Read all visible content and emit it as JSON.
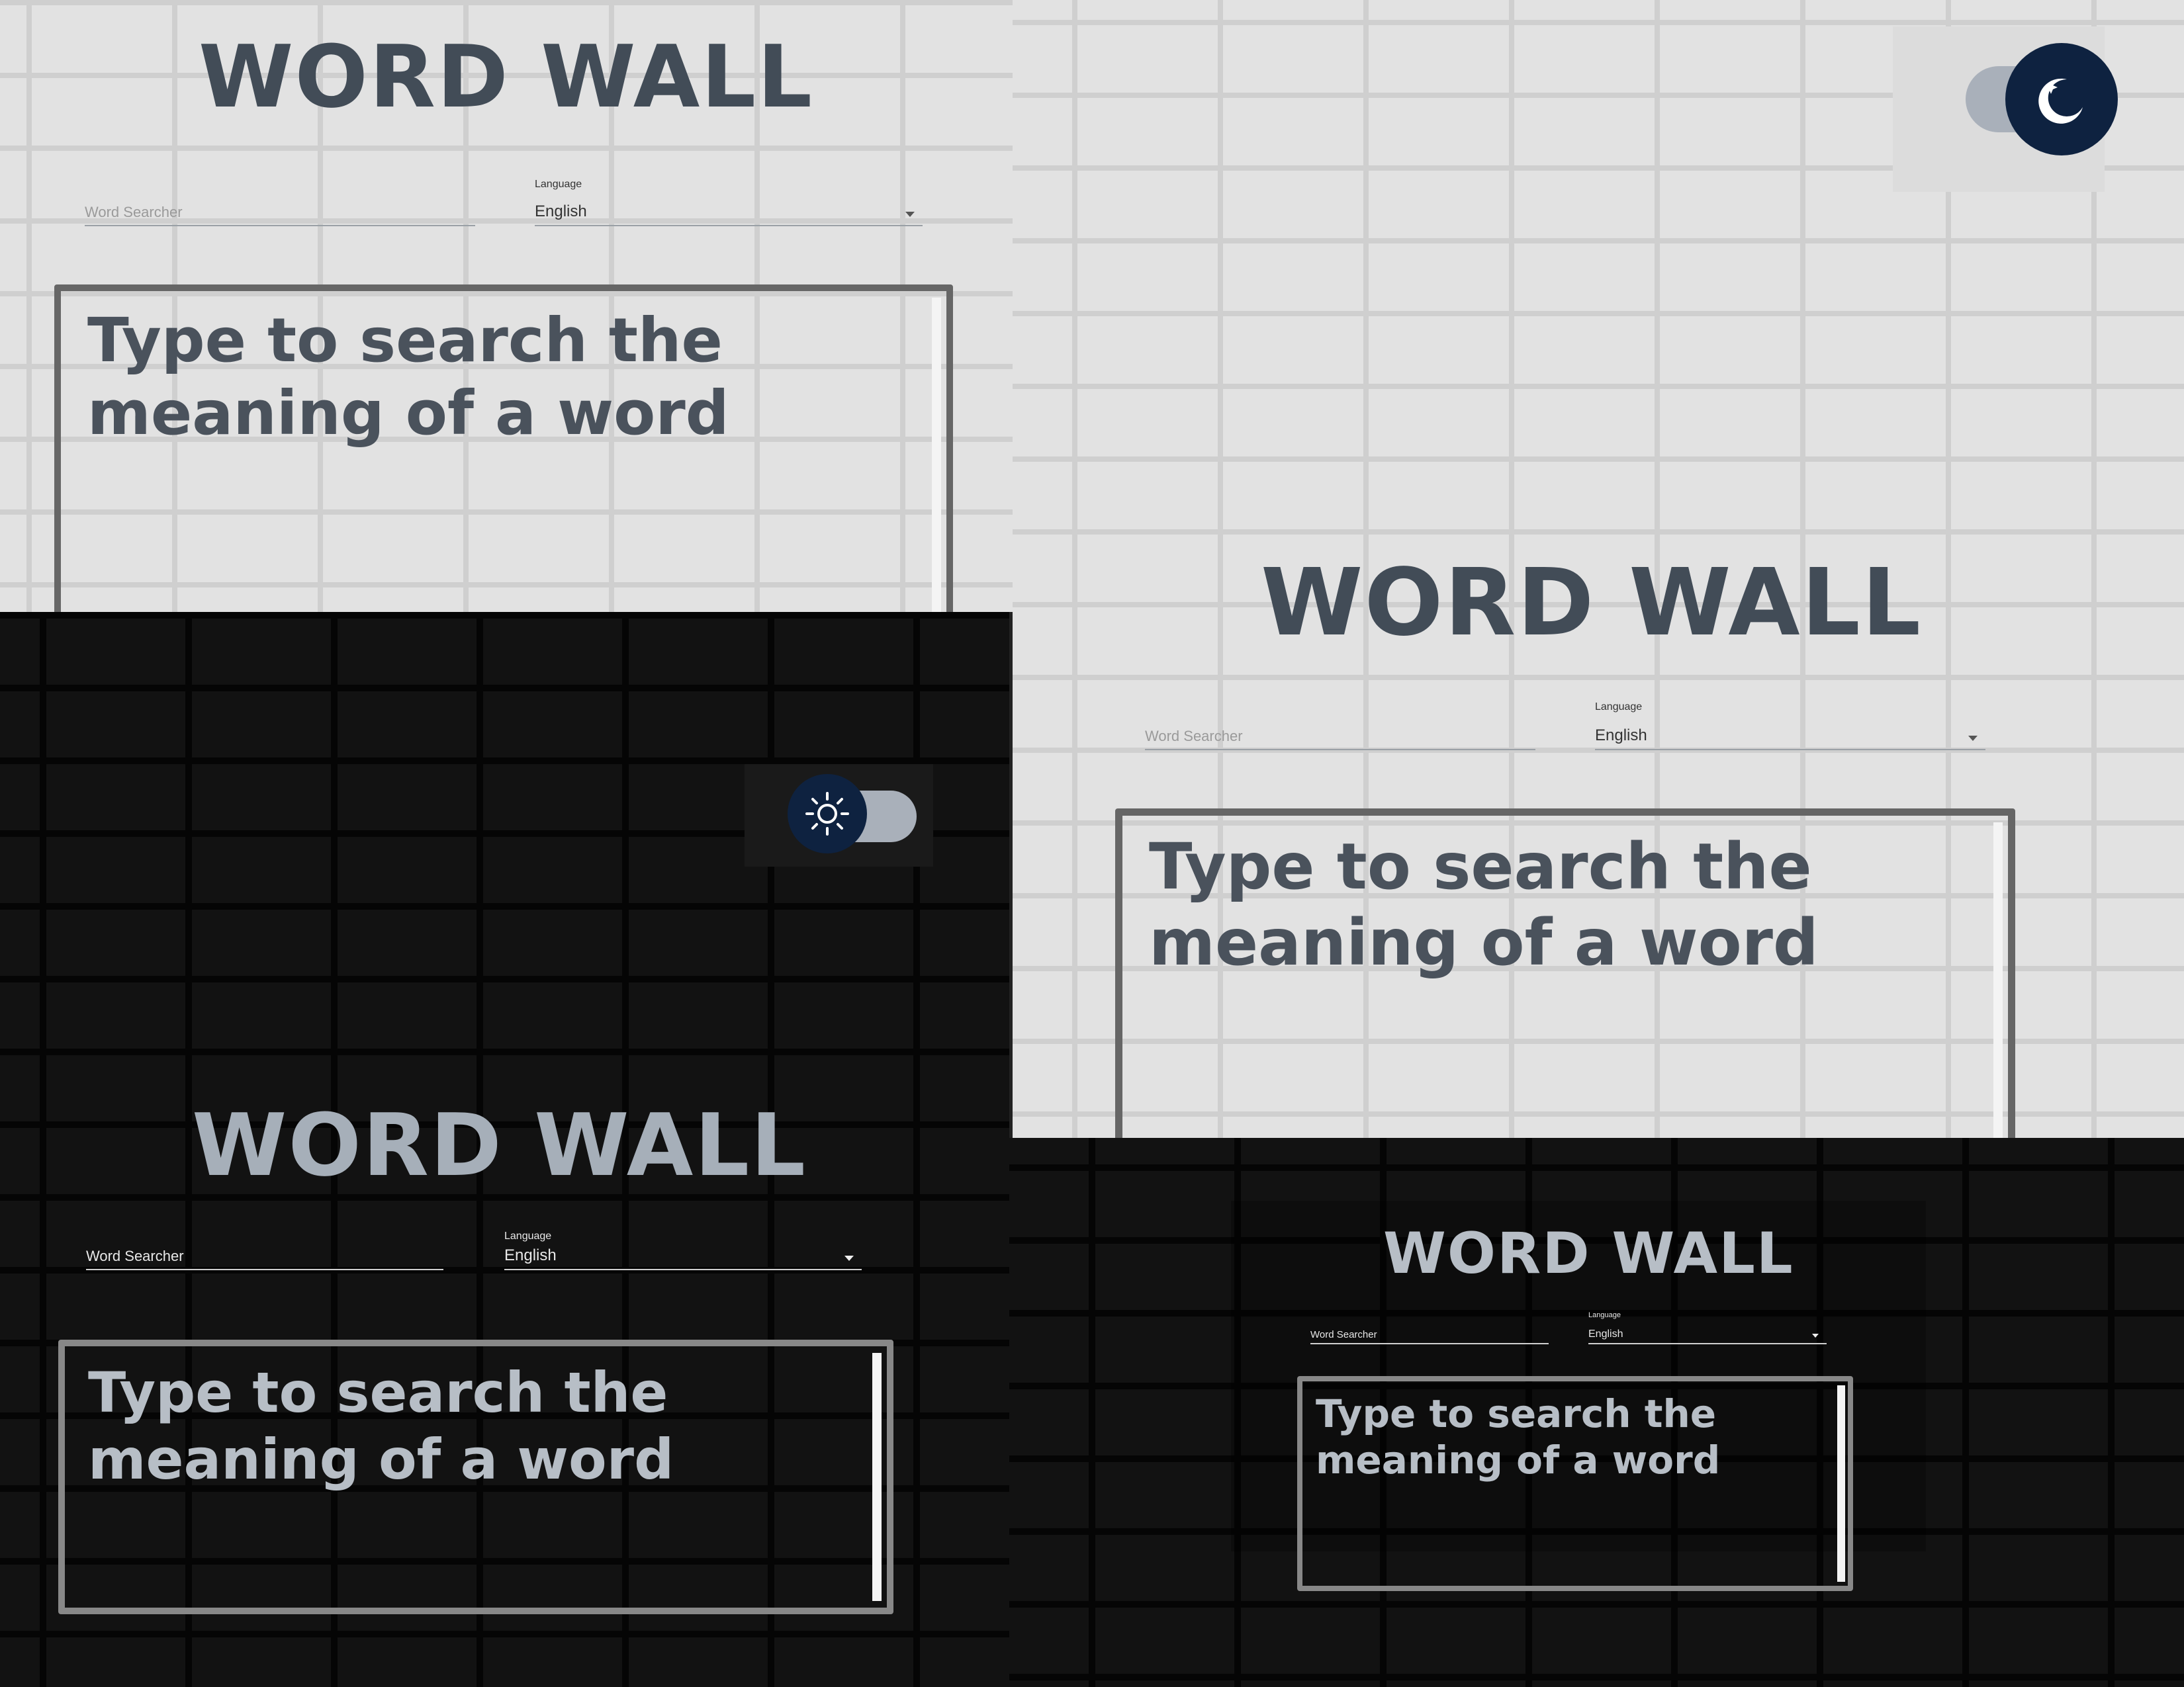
{
  "app": {
    "title": "WORD WALL",
    "search_placeholder": "Word Searcher",
    "language_label": "Language",
    "language_value": "English",
    "result_prompt_line1": "Type to search the",
    "result_prompt_line2": "meaning of a word"
  },
  "theme_toggle": {
    "light_mode_icon": "moon-stars-icon",
    "dark_mode_icon": "sun-icon",
    "knob_color": "#0e2240",
    "track_color": "#a9b0ba"
  }
}
